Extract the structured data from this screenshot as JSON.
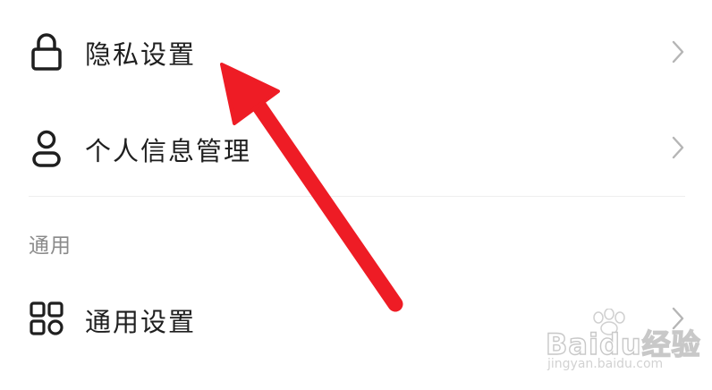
{
  "settings": {
    "items": [
      {
        "label": "隐私设置",
        "icon": "lock-icon"
      },
      {
        "label": "个人信息管理",
        "icon": "person-icon"
      }
    ],
    "section_header": "通用",
    "general_items": [
      {
        "label": "通用设置",
        "icon": "grid-icon"
      }
    ]
  },
  "annotation": {
    "arrow_color": "#ee1c25"
  },
  "watermark": {
    "logo_text": "Baidu经验",
    "url": "jingyan.baidu.com"
  }
}
